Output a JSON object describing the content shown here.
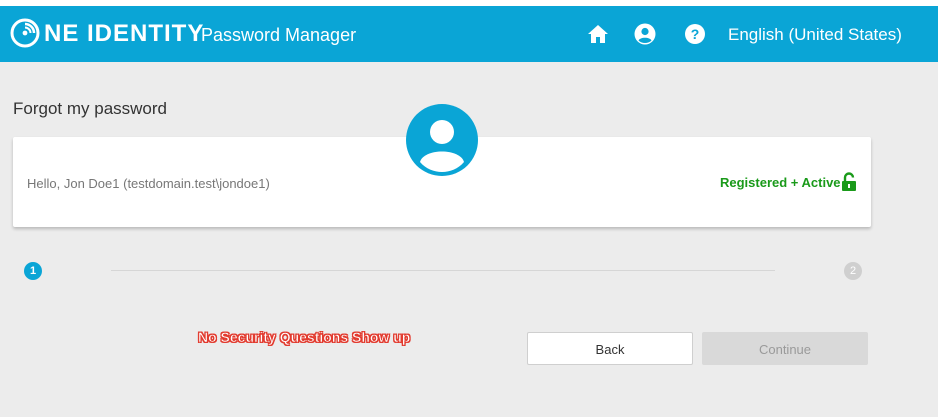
{
  "header": {
    "logo_text": "NE IDENTITY",
    "logo_full": "ONE IDENTITY",
    "app_title": "Password Manager",
    "language": "English (United States)",
    "icons": [
      "home-icon",
      "user-icon",
      "help-icon"
    ],
    "background_color": "#0aa5d6"
  },
  "page": {
    "heading": "Forgot my password"
  },
  "user_card": {
    "greeting": "Hello, Jon Doe1 (testdomain.test\\jondoe1)",
    "status": "Registered + Active",
    "status_color": "#1a9a1a",
    "avatar_icon": "user-avatar-icon",
    "lock_icon": "unlocked-icon"
  },
  "steps": {
    "current": "1",
    "next": "2"
  },
  "annotation": {
    "text": "No Security Questions Show up",
    "color": "#e23a2e"
  },
  "buttons": {
    "back": "Back",
    "continue": "Continue"
  }
}
